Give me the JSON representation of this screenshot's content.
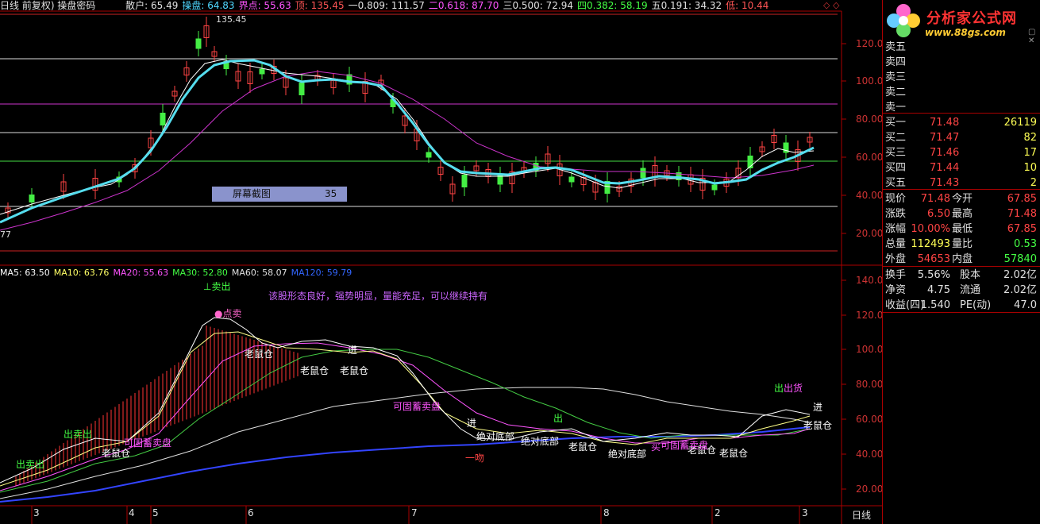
{
  "header": {
    "title": "日线 前复权) 操盘密码",
    "items": [
      {
        "label": "散户:",
        "value": "65.49",
        "color": "#e0e0e0"
      },
      {
        "label": "操盘:",
        "value": "64.83",
        "color": "#4fd8ff"
      },
      {
        "label": "界点:",
        "value": "55.63",
        "color": "#ff55ff"
      },
      {
        "label": "顶:",
        "value": "135.45",
        "color": "#ff5555"
      },
      {
        "label": "一0.809:",
        "value": "111.57",
        "color": "#e0e0e0"
      },
      {
        "label": "二0.618:",
        "value": "87.70",
        "color": "#ff55ff"
      },
      {
        "label": "三0.500:",
        "value": "72.94",
        "color": "#e0e0e0"
      },
      {
        "label": "四0.382:",
        "value": "58.19",
        "color": "#44ff44"
      },
      {
        "label": "五0.191:",
        "value": "34.32",
        "color": "#e0e0e0"
      },
      {
        "label": "低:",
        "value": "10.44",
        "color": "#ff5555"
      }
    ]
  },
  "upper_chart": {
    "y_ticks": [
      "120.00",
      "100.00",
      "80.00",
      "60.00",
      "40.00",
      "20.00"
    ],
    "high_label": "135.45",
    "low_label": "77",
    "tooltip": {
      "label": "屏幕截图",
      "value": "35"
    }
  },
  "ma_legend": [
    {
      "label": "MA5:",
      "value": "63.50",
      "color": "#ffffff"
    },
    {
      "label": "MA10:",
      "value": "63.76",
      "color": "#ffff66"
    },
    {
      "label": "MA20:",
      "value": "55.63",
      "color": "#ff55ff"
    },
    {
      "label": "MA30:",
      "value": "52.80",
      "color": "#44ff44"
    },
    {
      "label": "MA60:",
      "value": "58.07",
      "color": "#e0e0e0"
    },
    {
      "label": "MA120:",
      "value": "59.79",
      "color": "#3366ff"
    }
  ],
  "lower_chart": {
    "y_ticks": [
      "140.00",
      "120.00",
      "100.00",
      "80.00",
      "60.00",
      "40.00",
      "20.00"
    ],
    "comment": "该股形态良好，强势明显，量能充足，可以继续持有",
    "annotations": {
      "sell_top": "卖出",
      "dian": "点卖",
      "out_buy1": "出卖出",
      "out_buy2": "出卖出",
      "cang": "老鼠仓",
      "jin": "进",
      "doublekill": "可固蓄卖盘",
      "jueduidibu": "绝对底部",
      "out": "出",
      "out_goods": "出货",
      "zhong": "一吻",
      "buy": "买"
    }
  },
  "x_axis": {
    "months": [
      "3",
      "4",
      "5",
      "6",
      "7",
      "8",
      "2",
      "3"
    ],
    "period": "日线"
  },
  "quote_panel": {
    "brand": "分析家公式网",
    "site": "www.88gs.com",
    "sell_labels": [
      "卖五",
      "卖四",
      "卖三",
      "卖二",
      "卖一"
    ],
    "buy_rows": [
      {
        "label": "买一",
        "price": "71.48",
        "vol": "26119"
      },
      {
        "label": "买二",
        "price": "71.47",
        "vol": "82"
      },
      {
        "label": "买三",
        "price": "71.46",
        "vol": "17"
      },
      {
        "label": "买四",
        "price": "71.44",
        "vol": "10"
      },
      {
        "label": "买五",
        "price": "71.43",
        "vol": "2"
      }
    ],
    "stats": [
      {
        "l1": "现价",
        "v1": "71.48",
        "l2": "今开",
        "v2": "67.85"
      },
      {
        "l1": "涨跌",
        "v1": "6.50",
        "l2": "最高",
        "v2": "71.48"
      },
      {
        "l1": "涨幅",
        "v1": "10.00%",
        "l2": "最低",
        "v2": "67.85"
      },
      {
        "l1": "总量",
        "v1": "112493",
        "l2": "量比",
        "v2": "0.53"
      },
      {
        "l1": "外盘",
        "v1": "54653",
        "l2": "内盘",
        "v2": "57840"
      }
    ],
    "stats2": [
      {
        "l1": "换手",
        "v1": "5.56%",
        "l2": "股本",
        "v2": "2.02亿"
      },
      {
        "l1": "净资",
        "v1": "4.75",
        "l2": "流通",
        "v2": "2.02亿"
      },
      {
        "l1": "收益(四)",
        "v1": "1.540",
        "l2": "PE(动)",
        "v2": "47.0"
      }
    ]
  }
}
